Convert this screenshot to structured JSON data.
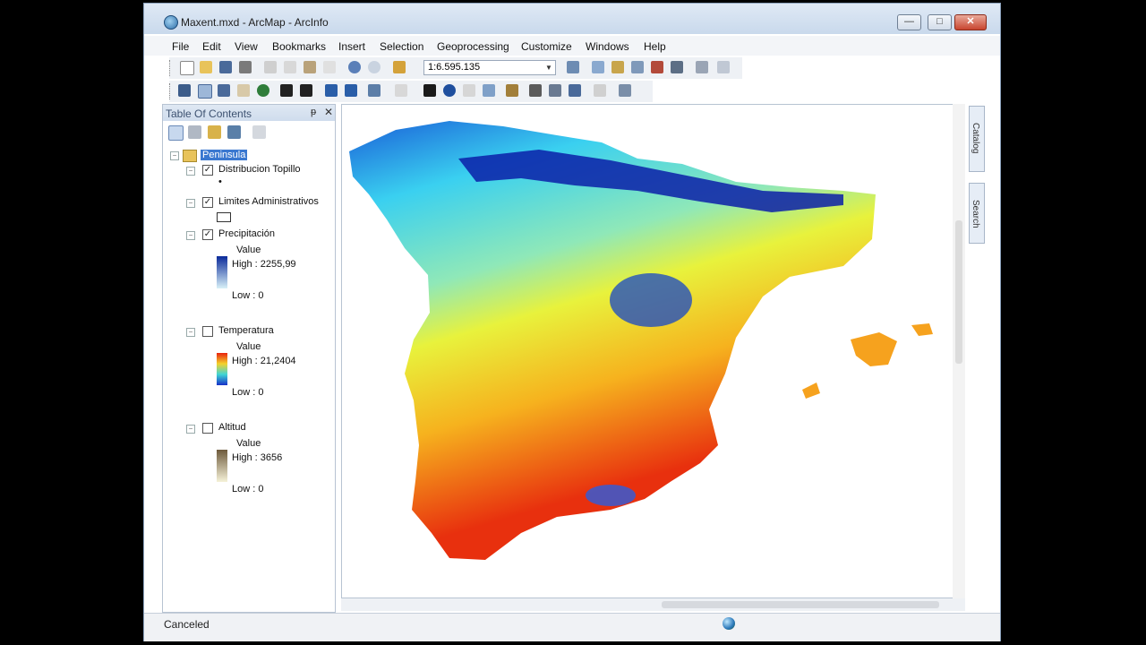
{
  "window": {
    "title": "Maxent.mxd - ArcMap - ArcInfo",
    "min_glyph": "—",
    "max_glyph": "□",
    "close_glyph": "✕"
  },
  "menu": [
    "File",
    "Edit",
    "View",
    "Bookmarks",
    "Insert",
    "Selection",
    "Geoprocessing",
    "Customize",
    "Windows",
    "Help"
  ],
  "toolbar": {
    "scale": "1:6.595.135"
  },
  "toc": {
    "title": "Table Of Contents",
    "pin_glyph": "ᵽ",
    "close_glyph": "✕",
    "root": "Peninsula",
    "layers": [
      {
        "name": "Distribucion Topillo",
        "checked": true,
        "symbol": "•"
      },
      {
        "name": "Limites Administrativos",
        "checked": true
      },
      {
        "name": "Precipitación",
        "checked": true,
        "legend_title": "Value",
        "high": "High : 2255,99",
        "low": "Low : 0",
        "ramp": [
          "#0a2a9a",
          "#d9f1f8"
        ]
      },
      {
        "name": "Temperatura",
        "checked": false,
        "legend_title": "Value",
        "high": "High : 21,2404",
        "low": "Low : 0",
        "ramp": [
          "#e8230e",
          "#f4d22a",
          "#3fd5d5",
          "#1730c8"
        ]
      },
      {
        "name": "Altitud",
        "checked": false,
        "legend_title": "Value",
        "high": "High : 3656",
        "low": "Low : 0",
        "ramp": [
          "#6e5a3c",
          "#f6f2d8"
        ]
      }
    ],
    "check_glyph": "✓",
    "collapse_glyph": "−"
  },
  "side_tabs": [
    "Catalog",
    "Search"
  ],
  "status": {
    "text": "Canceled"
  },
  "colors": {
    "precip_high": "#0a1fa8",
    "precip_mid": "#3ad0f0",
    "precip_low_mid": "#e8f23c",
    "precip_low": "#e8300e"
  }
}
